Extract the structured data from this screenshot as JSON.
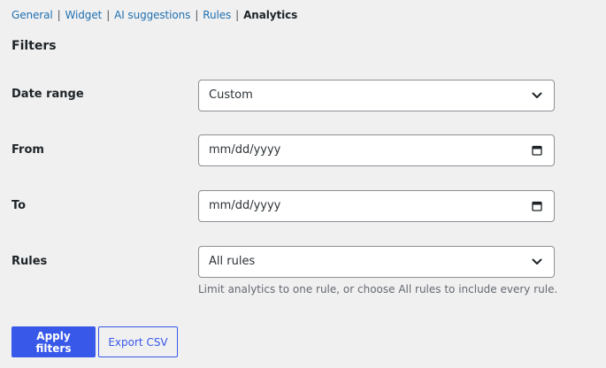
{
  "nav": {
    "items": [
      {
        "label": "General"
      },
      {
        "label": "Widget"
      },
      {
        "label": "AI suggestions"
      },
      {
        "label": "Rules"
      },
      {
        "label": "Analytics"
      }
    ],
    "separator": "|",
    "current_index": 4
  },
  "filters": {
    "title": "Filters",
    "date_range": {
      "label": "Date range",
      "value": "Custom",
      "icon": "chevron-down-icon"
    },
    "from": {
      "label": "From",
      "value": "mm/dd/yyyy",
      "icon": "calendar-icon"
    },
    "to": {
      "label": "To",
      "value": "mm/dd/yyyy",
      "icon": "calendar-icon"
    },
    "rules": {
      "label": "Rules",
      "value": "All rules",
      "icon": "chevron-down-icon",
      "help": "Limit analytics to one rule, or choose All rules to include every rule."
    }
  },
  "actions": {
    "apply_label": "Apply filters",
    "export_label": "Export CSV"
  },
  "colors": {
    "link": "#2271b1",
    "primary": "#3858e9",
    "background": "#f0f0f1",
    "text": "#1d2327",
    "help_text": "#646970",
    "border": "#8c8f94"
  }
}
